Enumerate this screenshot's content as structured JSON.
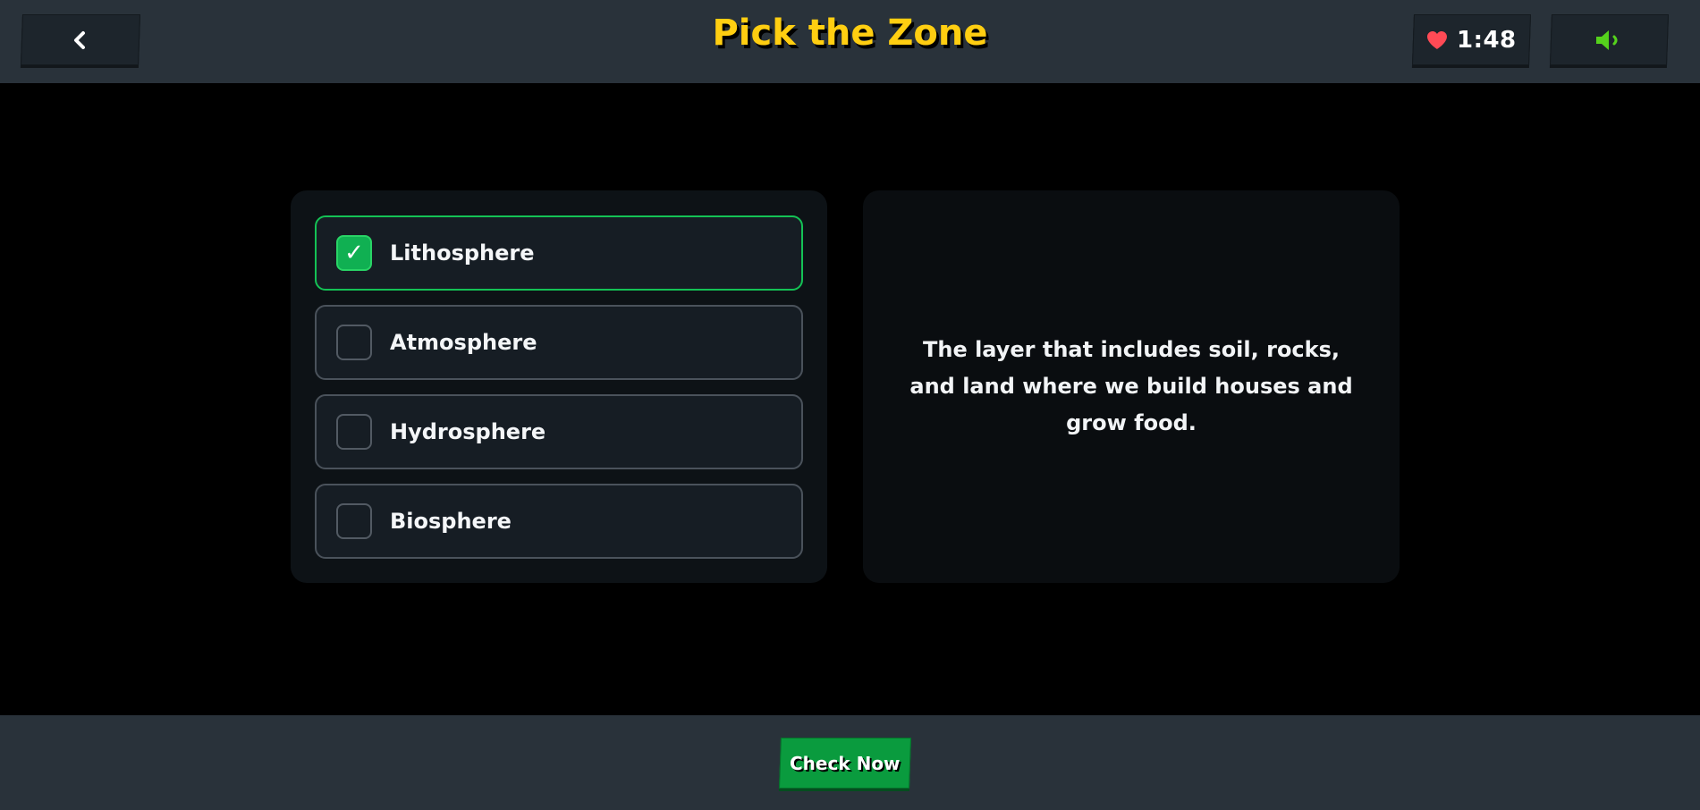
{
  "header": {
    "title": "Pick the Zone",
    "back_icon": "chevron-left-icon",
    "timer": {
      "icon": "heart-icon",
      "value": "1:48"
    },
    "sound_icon": "speaker-icon"
  },
  "options": [
    {
      "label": "Lithosphere",
      "selected": true
    },
    {
      "label": "Atmosphere",
      "selected": false
    },
    {
      "label": "Hydrosphere",
      "selected": false
    },
    {
      "label": "Biosphere",
      "selected": false
    }
  ],
  "clue": {
    "text": "The layer that includes soil, rocks, and land where we build houses and grow food."
  },
  "footer": {
    "check_label": "Check Now"
  },
  "colors": {
    "title": "#ffce11",
    "bar": "#29323a",
    "selected_border": "#14c255",
    "check_button": "#0a9b3e",
    "sound_icon": "#55d21c",
    "heart": "#ff4a55"
  }
}
